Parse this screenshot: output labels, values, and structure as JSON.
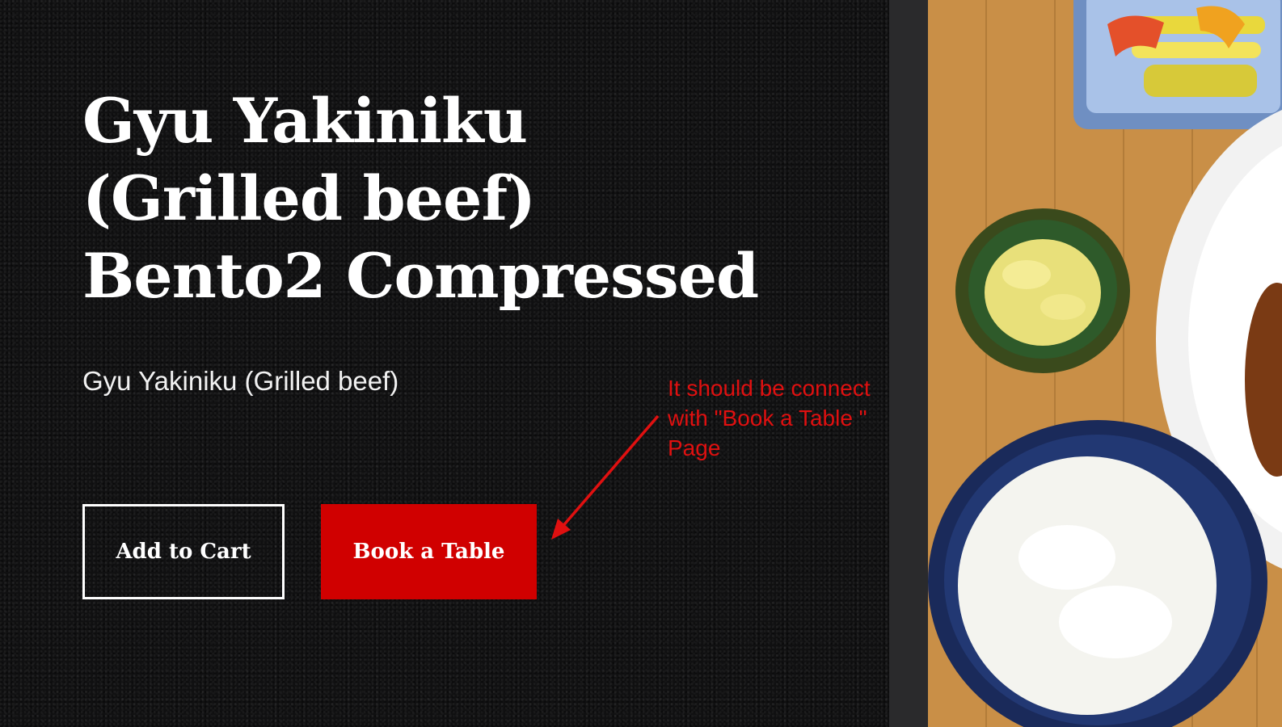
{
  "product": {
    "title": "Gyu Yakiniku (Grilled beef) Bento2 Compressed",
    "subtitle": "Gyu Yakiniku (Grilled beef)"
  },
  "actions": {
    "add_to_cart_label": "Add to Cart",
    "book_table_label": "Book a Table"
  },
  "annotation": {
    "note": "It should be connect with \"Book a Table \" Page"
  },
  "colors": {
    "background": "#101011",
    "accent_red": "#d00000",
    "annotation_red": "#e01010",
    "text": "#ffffff"
  },
  "image": {
    "icon": "food-bento-photo"
  }
}
